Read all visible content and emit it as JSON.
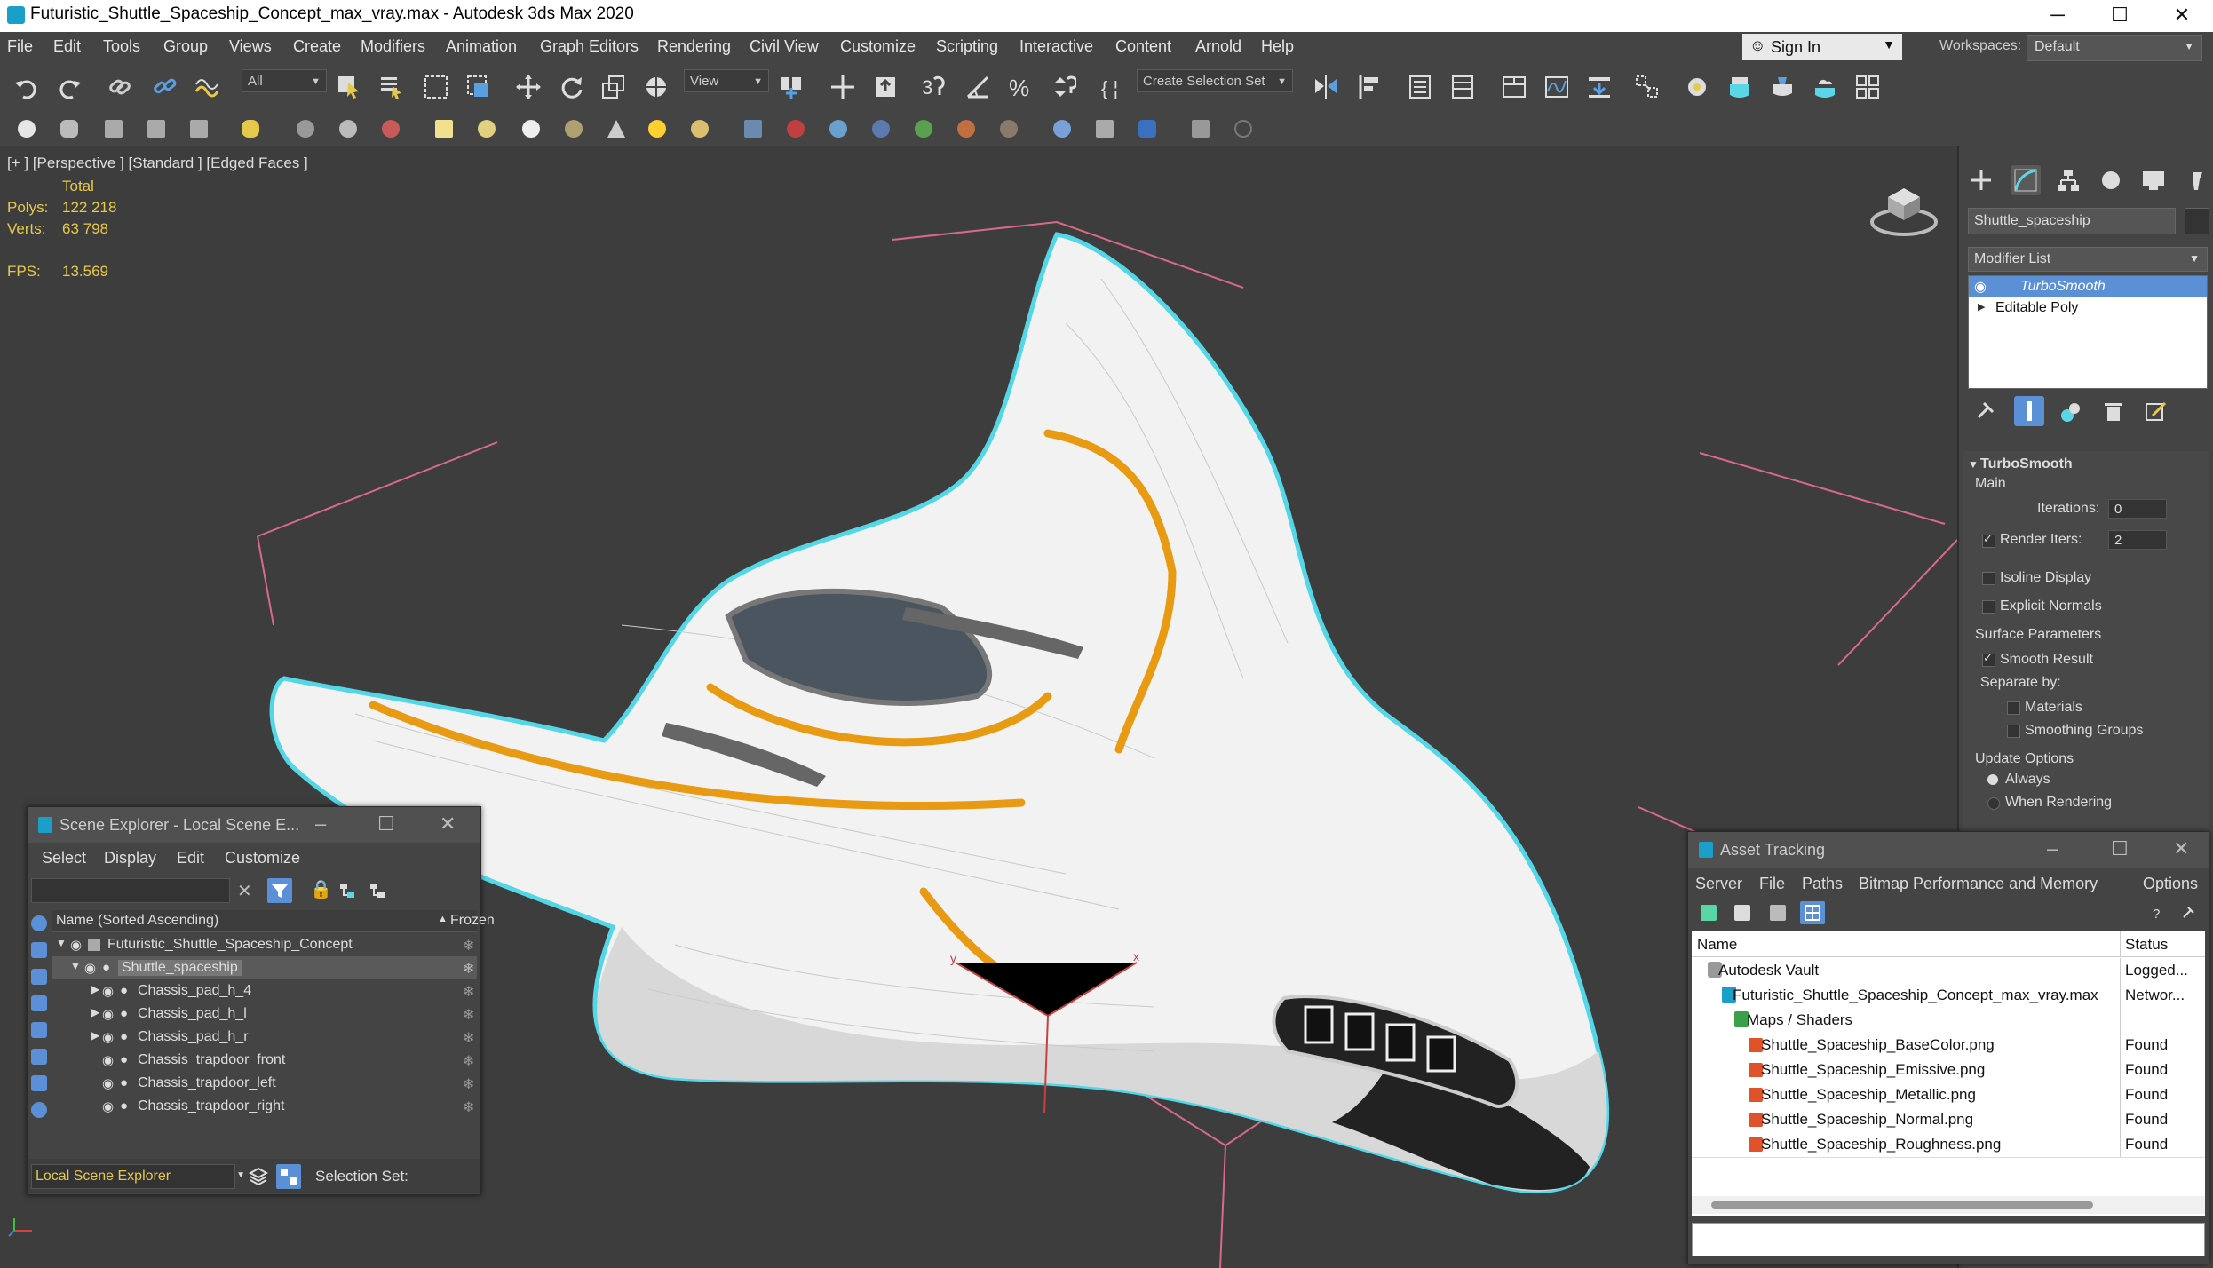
{
  "window": {
    "title": "Futuristic_Shuttle_Spaceship_Concept_max_vray.max - Autodesk 3ds Max 2020",
    "minimize": "─",
    "maximize": "☐",
    "close": "✕"
  },
  "menu": {
    "items": [
      "File",
      "Edit",
      "Tools",
      "Group",
      "Views",
      "Create",
      "Modifiers",
      "Animation",
      "Graph Editors",
      "Rendering",
      "Civil View",
      "Customize",
      "Scripting",
      "Interactive",
      "Content",
      "Arnold",
      "Help"
    ],
    "sign_in": "Sign In",
    "workspaces_label": "Workspaces:",
    "workspaces_value": "Default"
  },
  "toolbar": {
    "filter_dropdown": "All",
    "view_dropdown": "View",
    "selection_set_dropdown": "Create Selection Set"
  },
  "viewport": {
    "label": "[+ ] [Perspective ] [Standard ] [Edged Faces ]",
    "stats": {
      "total_label": "Total",
      "polys_label": "Polys:",
      "polys_value": "122 218",
      "verts_label": "Verts:",
      "verts_value": "63 798",
      "fps_label": "FPS:",
      "fps_value": "13.569"
    },
    "axis_x": "x",
    "axis_y": "y",
    "axis_z": "z"
  },
  "command_panel": {
    "object_name": "Shuttle_spaceship",
    "modifier_list_label": "Modifier List",
    "modifier_stack": [
      "TurboSmooth",
      "Editable Poly"
    ],
    "rollout_title": "TurboSmooth",
    "main_label": "Main",
    "iterations_label": "Iterations:",
    "iterations_value": "0",
    "render_iters_label": "Render Iters:",
    "render_iters_value": "2",
    "isoline_display": "Isoline Display",
    "explicit_normals": "Explicit Normals",
    "surface_params_label": "Surface Parameters",
    "smooth_result": "Smooth Result",
    "separate_by": "Separate by:",
    "materials": "Materials",
    "smoothing_groups": "Smoothing Groups",
    "update_options": "Update Options",
    "always": "Always",
    "when_rendering": "When Rendering"
  },
  "scene_explorer": {
    "title": "Scene Explorer - Local Scene E...",
    "menu": [
      "Select",
      "Display",
      "Edit",
      "Customize"
    ],
    "column_name": "Name (Sorted Ascending)",
    "column_frozen": "Frozen",
    "rows": [
      {
        "label": "Futuristic_Shuttle_Spaceship_Concept",
        "indent": 0
      },
      {
        "label": "Shuttle_spaceship",
        "indent": 1
      },
      {
        "label": "Chassis_pad_h_4",
        "indent": 2
      },
      {
        "label": "Chassis_pad_h_l",
        "indent": 2
      },
      {
        "label": "Chassis_pad_h_r",
        "indent": 2
      },
      {
        "label": "Chassis_trapdoor_front",
        "indent": 2
      },
      {
        "label": "Chassis_trapdoor_left",
        "indent": 2
      },
      {
        "label": "Chassis_trapdoor_right",
        "indent": 2
      }
    ],
    "footer_dropdown": "Local Scene Explorer",
    "selection_set_label": "Selection Set:"
  },
  "asset_tracking": {
    "title": "Asset Tracking",
    "menu": [
      "Server",
      "File",
      "Paths",
      "Bitmap Performance and Memory",
      "Options"
    ],
    "column_name": "Name",
    "column_status": "Status",
    "rows": [
      {
        "name": "Autodesk Vault",
        "status": "Logged...",
        "indent": 0
      },
      {
        "name": "Futuristic_Shuttle_Spaceship_Concept_max_vray.max",
        "status": "Networ...",
        "indent": 1
      },
      {
        "name": "Maps / Shaders",
        "status": "",
        "indent": 2
      },
      {
        "name": "Shuttle_Spaceship_BaseColor.png",
        "status": "Found",
        "indent": 3
      },
      {
        "name": "Shuttle_Spaceship_Emissive.png",
        "status": "Found",
        "indent": 3
      },
      {
        "name": "Shuttle_Spaceship_Metallic.png",
        "status": "Found",
        "indent": 3
      },
      {
        "name": "Shuttle_Spaceship_Normal.png",
        "status": "Found",
        "indent": 3
      },
      {
        "name": "Shuttle_Spaceship_Roughness.png",
        "status": "Found",
        "indent": 3
      }
    ]
  },
  "colors": {
    "accent_blue": "#5b8fd6",
    "selection_cyan": "#53d6e6",
    "stats_yellow": "#e6c84a",
    "stripe_orange": "#e89a12"
  }
}
